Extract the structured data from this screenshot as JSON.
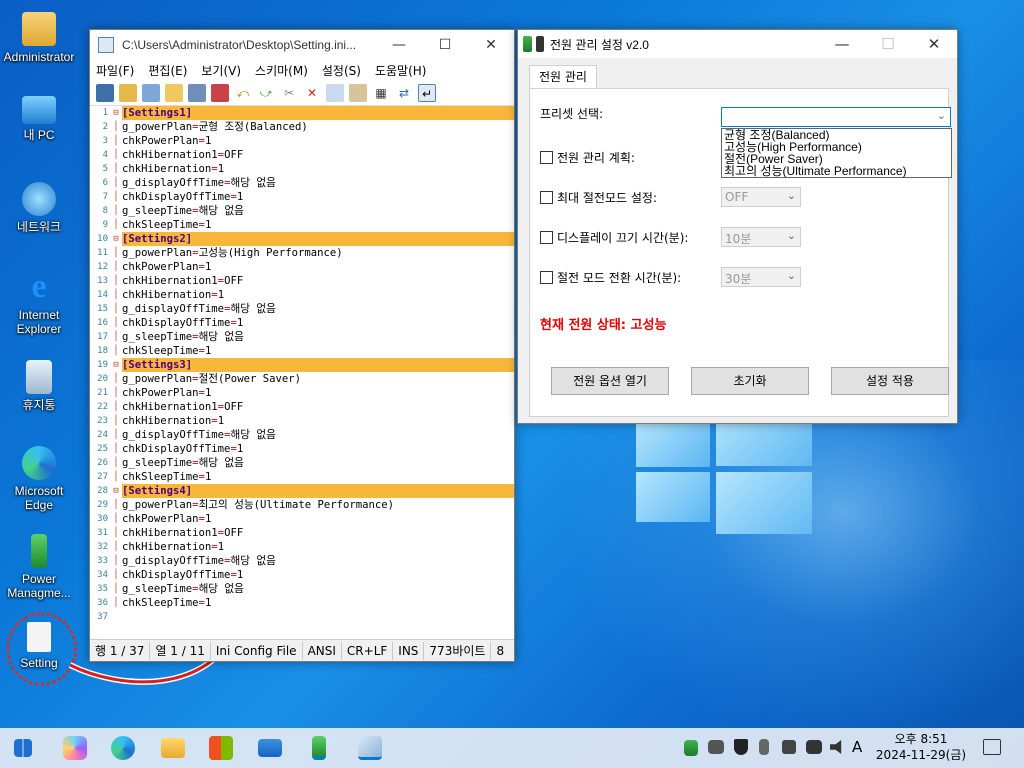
{
  "desktop": {
    "icons": [
      {
        "label": "Administrator",
        "icon": "user-folder-icon"
      },
      {
        "label": "내 PC",
        "icon": "computer-icon"
      },
      {
        "label": "네트워크",
        "icon": "network-icon"
      },
      {
        "label": "Internet Explorer",
        "icon": "internet-explorer-icon"
      },
      {
        "label": "휴지통",
        "icon": "recycle-bin-icon"
      },
      {
        "label": "Microsoft Edge",
        "icon": "edge-icon"
      },
      {
        "label": "Power Managme...",
        "icon": "power-management-icon"
      },
      {
        "label": "Setting",
        "icon": "settings-file-icon"
      }
    ]
  },
  "notepad": {
    "title": "C:\\Users\\Administrator\\Desktop\\Setting.ini...",
    "menu": [
      "파일(F)",
      "편집(E)",
      "보기(V)",
      "스키마(M)",
      "설정(S)",
      "도움말(H)"
    ],
    "lines": [
      {
        "n": "1",
        "t": "[Settings1]",
        "sect": true
      },
      {
        "n": "2",
        "k": "g_powerPlan",
        "v": "균형 조정(Balanced)"
      },
      {
        "n": "3",
        "k": "chkPowerPlan",
        "v": "1"
      },
      {
        "n": "4",
        "k": "chkHibernation1",
        "v": "OFF"
      },
      {
        "n": "5",
        "k": "chkHibernation",
        "v": "1"
      },
      {
        "n": "6",
        "k": "g_displayOffTime",
        "v": "해당 없음"
      },
      {
        "n": "7",
        "k": "chkDisplayOffTime",
        "v": "1"
      },
      {
        "n": "8",
        "k": "g_sleepTime",
        "v": "해당 없음"
      },
      {
        "n": "9",
        "k": "chkSleepTime",
        "v": "1"
      },
      {
        "n": "10",
        "t": "[Settings2]",
        "sect": true
      },
      {
        "n": "11",
        "k": "g_powerPlan",
        "v": "고성능(High Performance)"
      },
      {
        "n": "12",
        "k": "chkPowerPlan",
        "v": "1"
      },
      {
        "n": "13",
        "k": "chkHibernation1",
        "v": "OFF"
      },
      {
        "n": "14",
        "k": "chkHibernation",
        "v": "1"
      },
      {
        "n": "15",
        "k": "g_displayOffTime",
        "v": "해당 없음"
      },
      {
        "n": "16",
        "k": "chkDisplayOffTime",
        "v": "1"
      },
      {
        "n": "17",
        "k": "g_sleepTime",
        "v": "해당 없음"
      },
      {
        "n": "18",
        "k": "chkSleepTime",
        "v": "1"
      },
      {
        "n": "19",
        "t": "[Settings3]",
        "sect": true
      },
      {
        "n": "20",
        "k": "g_powerPlan",
        "v": "절전(Power Saver)"
      },
      {
        "n": "21",
        "k": "chkPowerPlan",
        "v": "1"
      },
      {
        "n": "22",
        "k": "chkHibernation1",
        "v": "OFF"
      },
      {
        "n": "23",
        "k": "chkHibernation",
        "v": "1"
      },
      {
        "n": "24",
        "k": "g_displayOffTime",
        "v": "해당 없음"
      },
      {
        "n": "25",
        "k": "chkDisplayOffTime",
        "v": "1"
      },
      {
        "n": "26",
        "k": "g_sleepTime",
        "v": "해당 없음"
      },
      {
        "n": "27",
        "k": "chkSleepTime",
        "v": "1"
      },
      {
        "n": "28",
        "t": "[Settings4]",
        "sect": true
      },
      {
        "n": "29",
        "k": "g_powerPlan",
        "v": "최고의 성능(Ultimate Performance)"
      },
      {
        "n": "30",
        "k": "chkPowerPlan",
        "v": "1"
      },
      {
        "n": "31",
        "k": "chkHibernation1",
        "v": "OFF"
      },
      {
        "n": "32",
        "k": "chkHibernation",
        "v": "1"
      },
      {
        "n": "33",
        "k": "g_displayOffTime",
        "v": "해당 없음"
      },
      {
        "n": "34",
        "k": "chkDisplayOffTime",
        "v": "1"
      },
      {
        "n": "35",
        "k": "g_sleepTime",
        "v": "해당 없음"
      },
      {
        "n": "36",
        "k": "chkSleepTime",
        "v": "1"
      },
      {
        "n": "37",
        "t": ""
      }
    ],
    "status": {
      "line": "행 1 / 37",
      "col": "열 1 / 11",
      "filetype": "Ini Config File",
      "encoding": "ANSI",
      "eol": "CR+LF",
      "mode": "INS",
      "size": "773바이트",
      "extra": "8"
    }
  },
  "power": {
    "title": "전원 관리 설정 v2.0",
    "tab": "전원 관리",
    "preset_label": "프리셋 선택:",
    "preset_value": "",
    "preset_options": [
      "균형 조정(Balanced)",
      "고성능(High Performance)",
      "절전(Power Saver)",
      "최고의 성능(Ultimate Performance)"
    ],
    "plan_label": "전원 관리 계획:",
    "max_saver_label": "최대 절전모드 설정:",
    "max_saver_value": "OFF",
    "display_off_label": "디스플레이 끄기 시간(분):",
    "display_off_value": "10분",
    "sleep_label": "절전 모드 전환 시간(분):",
    "sleep_value": "30분",
    "status_text": "현재 전원 상태: 고성능",
    "buttons": {
      "open_options": "전원 옵션 열기",
      "reset": "초기화",
      "apply": "설정 적용"
    }
  },
  "taskbar": {
    "clock_time": "오후 8:51",
    "clock_date": "2024-11-29(금)",
    "ime": "A"
  }
}
